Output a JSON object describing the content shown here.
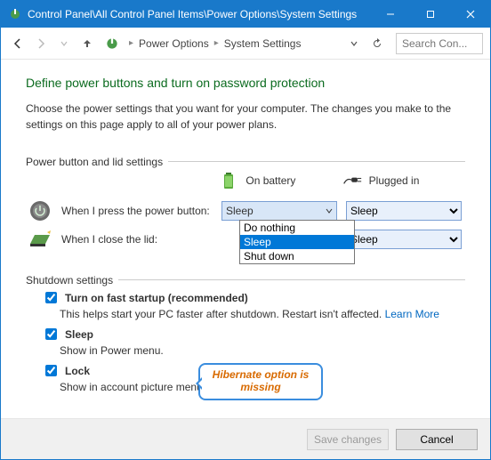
{
  "titlebar": {
    "path": "Control Panel\\All Control Panel Items\\Power Options\\System Settings"
  },
  "breadcrumb": {
    "items": [
      "Power Options",
      "System Settings"
    ]
  },
  "search": {
    "placeholder": "Search Con..."
  },
  "heading": "Define power buttons and turn on password protection",
  "subtext": "Choose the power settings that you want for your computer. The changes you make to the settings on this page apply to all of your power plans.",
  "section1_label": "Power button and lid settings",
  "col_battery": "On battery",
  "col_plugged": "Plugged in",
  "row_power_btn": "When I press the power button:",
  "row_lid": "When I close the lid:",
  "power_btn_battery_value": "Sleep",
  "power_btn_plugged_value": "Sleep",
  "lid_plugged_value": "Sleep",
  "dropdown_options": [
    "Do nothing",
    "Sleep",
    "Shut down"
  ],
  "section2_label": "Shutdown settings",
  "cb_fast_label": "Turn on fast startup (recommended)",
  "cb_fast_sub": "This helps start your PC faster after shutdown. Restart isn't affected.",
  "learn_more": "Learn More",
  "cb_sleep_label": "Sleep",
  "cb_sleep_sub": "Show in Power menu.",
  "cb_lock_label": "Lock",
  "cb_lock_sub": "Show in account picture menu.",
  "callout_text": "Hibernate option is missing",
  "btn_save": "Save changes",
  "btn_cancel": "Cancel"
}
